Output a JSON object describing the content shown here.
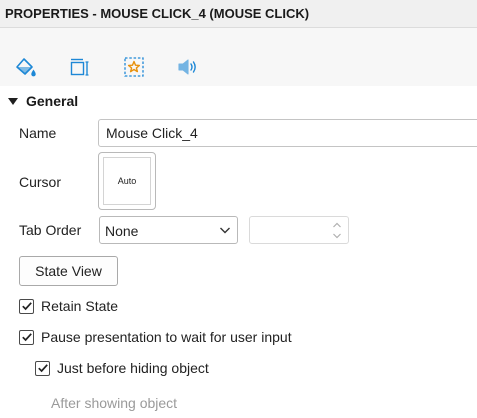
{
  "panel": {
    "title": "PROPERTIES - MOUSE CLICK_4 (MOUSE CLICK)"
  },
  "tabs": [
    {
      "icon": "paint-bucket-icon",
      "selected": false
    },
    {
      "icon": "size-position-icon",
      "selected": false
    },
    {
      "icon": "star-options-icon",
      "selected": true
    },
    {
      "icon": "speaker-audio-icon",
      "selected": false
    }
  ],
  "colors": {
    "accent": "#1e88d6",
    "star": "#e8910c",
    "tab_background": "#f7f7f7",
    "header_background": "#f0f0f0"
  },
  "section": {
    "title": "General",
    "expanded": true
  },
  "name_field": {
    "label": "Name",
    "value": "Mouse Click_4"
  },
  "cursor_field": {
    "label": "Cursor",
    "value": "Auto"
  },
  "tab_order": {
    "label": "Tab Order",
    "selected": "None",
    "number_value": ""
  },
  "state_view_button": {
    "label": "State View"
  },
  "options": [
    {
      "label": "Retain State",
      "checked": true,
      "enabled": true
    },
    {
      "label": "Pause presentation to wait for user input",
      "checked": true,
      "enabled": true
    },
    {
      "label": "Just before hiding object",
      "checked": true,
      "enabled": true
    },
    {
      "label": "After showing object",
      "checked": false,
      "enabled": false
    }
  ]
}
